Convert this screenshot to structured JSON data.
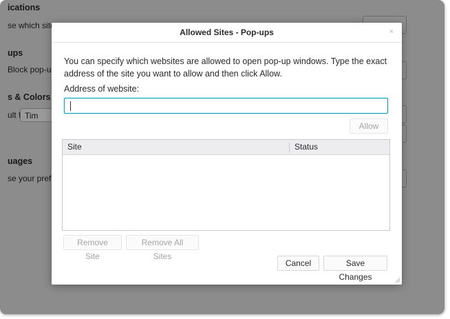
{
  "background": {
    "sections": [
      {
        "heading": "ications",
        "text": "se which site"
      },
      {
        "heading": "ups",
        "text": "Block pop-up"
      },
      {
        "heading": "s & Colors",
        "text": "ult font:",
        "select_value": "Tim"
      },
      {
        "heading": "uages",
        "text": "se your prefe"
      }
    ]
  },
  "dialog": {
    "title": "Allowed Sites - Pop-ups",
    "close_glyph": "×",
    "intro": "You can specify which websites are allowed to open pop-up windows. Type the exact address of the site you want to allow and then click Allow.",
    "address_label": "Address of website:",
    "address_value": "",
    "allow_label": "Allow",
    "table": {
      "columns": [
        "Site",
        "Status"
      ],
      "rows": []
    },
    "remove_site_label": "Remove Site",
    "remove_all_label": "Remove All Sites",
    "cancel_label": "Cancel",
    "save_label": "Save Changes"
  },
  "colors": {
    "accent": "#0aa1bd",
    "overlay": "#8c8c8c"
  }
}
